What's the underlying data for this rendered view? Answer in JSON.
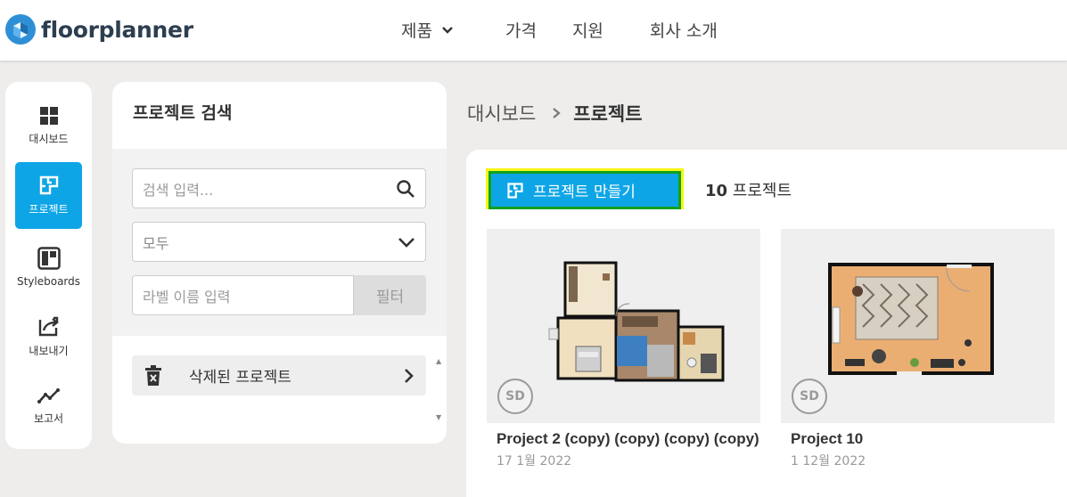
{
  "brand": {
    "name": "floorplanner"
  },
  "nav": {
    "products": "제품",
    "pricing": "가격",
    "support": "지원",
    "company": "회사 소개"
  },
  "sidebar": {
    "items": [
      {
        "label": "대시보드",
        "icon": "dashboard-grid-icon"
      },
      {
        "label": "프로젝트",
        "icon": "floorplan-icon",
        "active": true
      },
      {
        "label": "Styleboards",
        "icon": "styleboard-icon"
      },
      {
        "label": "내보내기",
        "icon": "export-icon"
      },
      {
        "label": "보고서",
        "icon": "report-chart-icon"
      }
    ]
  },
  "search": {
    "title": "프로젝트 검색",
    "search_placeholder": "검색 입력...",
    "select_value": "모두",
    "label_placeholder": "라벨 이름 입력",
    "filter_button": "필터",
    "deleted_projects": "삭제된 프로젝트"
  },
  "breadcrumb": {
    "root": "대시보드",
    "current": "프로젝트"
  },
  "projects": {
    "create_button": "프로젝트 만들기",
    "count": "10",
    "count_label": "프로젝트",
    "cards": [
      {
        "name": "Project 2 (copy) (copy) (copy) (copy)",
        "date": "17 1월 2022",
        "badge": "SD"
      },
      {
        "name": "Project 10",
        "date": "1 12월 2022",
        "badge": "SD"
      }
    ]
  },
  "colors": {
    "accent": "#0ea5e6",
    "highlight": "#f5f512",
    "highlight_border": "#10a020",
    "background": "#eeedeb"
  }
}
